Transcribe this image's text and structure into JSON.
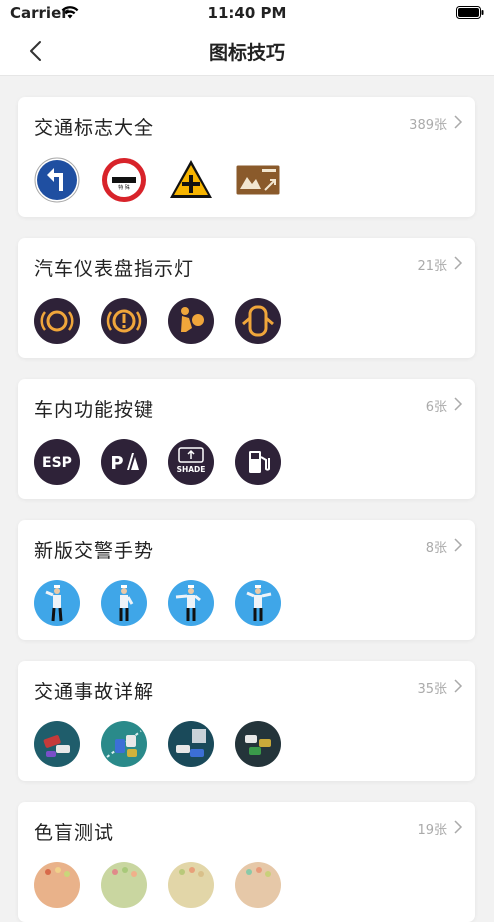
{
  "status": {
    "carrier": "Carrier",
    "time": "11:40 PM"
  },
  "nav": {
    "title": "图标技巧"
  },
  "cards": [
    {
      "title": "交通标志大全",
      "count": "389张",
      "thumbs": [
        "left-turn-sign-icon",
        "no-entry-sign-icon",
        "warning-crossroad-sign-icon",
        "tourist-direction-sign-icon"
      ]
    },
    {
      "title": "汽车仪表盘指示灯",
      "count": "21张",
      "thumbs": [
        "brake-pad-warning-icon",
        "brake-warning-icon",
        "airbag-warning-icon",
        "door-open-warning-icon"
      ]
    },
    {
      "title": "车内功能按键",
      "count": "6张",
      "thumbs": [
        "esp-button-icon",
        "parking-sensor-button-icon",
        "sunshade-button-icon",
        "fuel-icon"
      ]
    },
    {
      "title": "新版交警手势",
      "count": "8张",
      "thumbs": [
        "traffic-police-stop-icon",
        "traffic-police-straight-icon",
        "traffic-police-left-turn-icon",
        "traffic-police-right-turn-icon"
      ]
    },
    {
      "title": "交通事故详解",
      "count": "35张",
      "thumbs": [
        "accident-scene-1-icon",
        "accident-scene-2-icon",
        "accident-scene-3-icon",
        "accident-scene-4-icon"
      ]
    },
    {
      "title": "色盲测试",
      "count": "19张",
      "thumbs": [
        "color-plate-1-icon",
        "color-plate-2-icon",
        "color-plate-3-icon",
        "color-plate-4-icon"
      ]
    }
  ],
  "thumb_text": {
    "esp": "ESP",
    "shade": "SHADE",
    "park": "P"
  },
  "colors": {
    "background": "#f2f2f2",
    "card": "#ffffff",
    "count": "#aaaaaa",
    "dash_bg": "#2e2238",
    "dash_fg": "#f0a63b",
    "police_bg": "#3fa6e8"
  }
}
